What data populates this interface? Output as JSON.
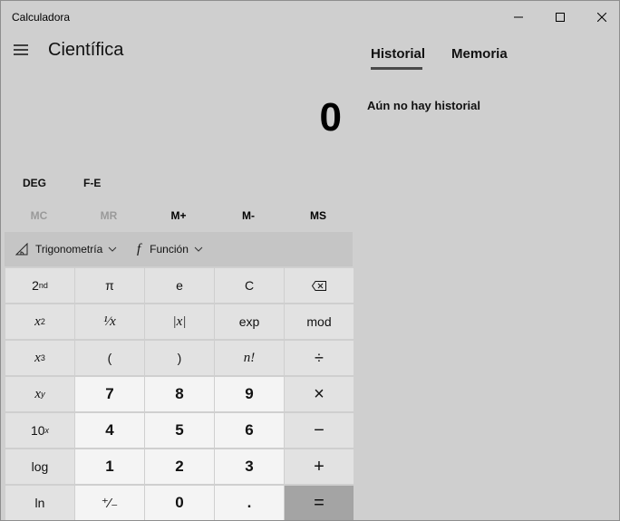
{
  "window": {
    "title": "Calculadora"
  },
  "header": {
    "mode": "Científica"
  },
  "history": {
    "tabs": [
      "Historial",
      "Memoria"
    ],
    "active_tab": "Historial",
    "empty_message": "Aún no hay historial"
  },
  "display": {
    "value": "0"
  },
  "modes": {
    "angle": "DEG",
    "fe": "F-E"
  },
  "memory": {
    "mc": "MC",
    "mr": "MR",
    "mplus": "M+",
    "mminus": "M-",
    "ms": "MS"
  },
  "function_bar": {
    "trig": "Trigonometría",
    "func": "Función"
  },
  "keys": {
    "second": "2",
    "second_sup": "nd",
    "pi": "π",
    "e": "e",
    "c": "C",
    "backspace_icon": "backspace-icon",
    "x2_base": "x",
    "x2_sup": "2",
    "inv": "¹⁄x",
    "abs": "|x|",
    "exp": "exp",
    "mod": "mod",
    "x3_base": "x",
    "x3_sup": "3",
    "lparen": "(",
    "rparen": ")",
    "fact": "n!",
    "divide": "÷",
    "xy_base": "x",
    "xy_sup": "y",
    "seven": "7",
    "eight": "8",
    "nine": "9",
    "multiply": "×",
    "ten_base": "10",
    "ten_sup": "x",
    "four": "4",
    "five": "5",
    "six": "6",
    "minus": "−",
    "log": "log",
    "one": "1",
    "two": "2",
    "three": "3",
    "plus": "+",
    "ln": "ln",
    "negate": "⁺⁄₋",
    "zero": "0",
    "dot": ".",
    "equals": "="
  }
}
